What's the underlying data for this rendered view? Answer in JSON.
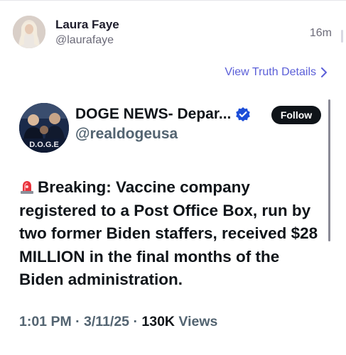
{
  "post": {
    "author_name": "Laura Faye",
    "author_handle": "@laurafaye",
    "timestamp": "16m",
    "view_details_label": "View Truth Details"
  },
  "embed": {
    "name": "DOGE NEWS- Depar...",
    "handle": "@realdogeusa",
    "avatar_text": "D.O.G.E",
    "follow_label": "Follow",
    "text": "Breaking: Vaccine company registered to a Post Office Box, run by two former Biden staffers, received $28 MILLION in the final months of the Biden administration.",
    "time": "1:01 PM",
    "date": "3/11/25",
    "views_count": "130K",
    "views_label": "Views"
  },
  "icons": {
    "siren": "police-light-icon",
    "verified": "verified-badge-icon",
    "chevron": "chevron-right-icon"
  },
  "colors": {
    "link": "#5b5fd8",
    "verified": "#1d9bf0",
    "follow_bg": "#0f1419",
    "muted": "#536471"
  }
}
